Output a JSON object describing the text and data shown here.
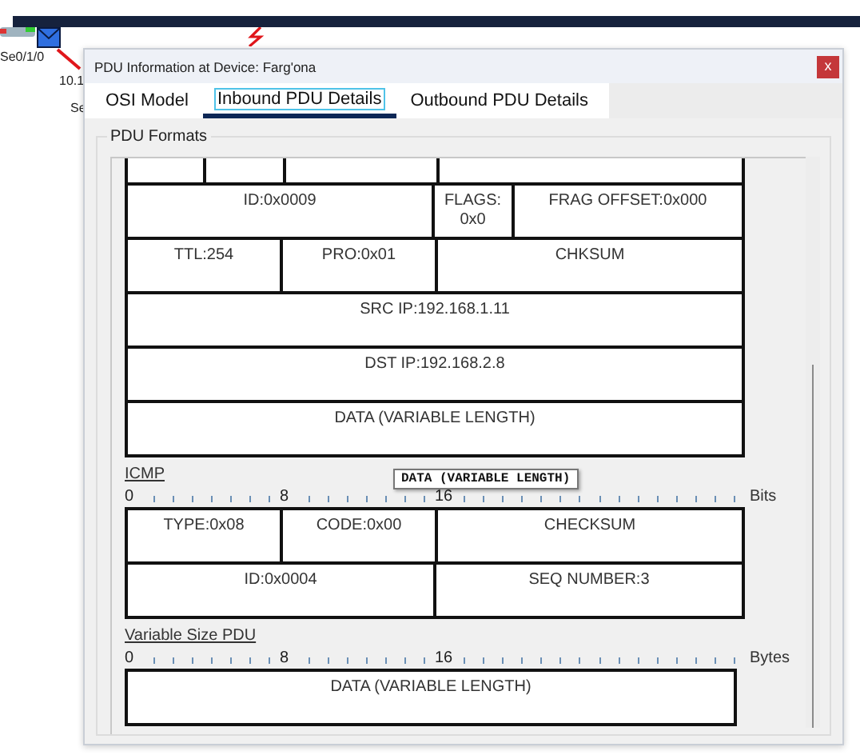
{
  "canvas": {
    "labels": [
      "Se0/1/0",
      "10.1",
      "Se"
    ]
  },
  "dialog": {
    "title": "PDU Information at Device: Farg'ona",
    "close": "x",
    "tabs": [
      {
        "label": "OSI Model",
        "selected": false
      },
      {
        "label": "Inbound PDU Details",
        "selected": true
      },
      {
        "label": "Outbound PDU Details",
        "selected": false
      }
    ],
    "group_title": "PDU Formats",
    "sections": [
      {
        "kind": "ip",
        "cut_row": true,
        "rows": [
          {
            "fields": [
              "ID:0x0009",
              "FLAGS: 0x0",
              "FRAG OFFSET:0x000"
            ]
          },
          {
            "fields": [
              "TTL:254",
              "PRO:0x01",
              "CHKSUM"
            ]
          },
          {
            "fields": [
              "SRC IP:192.168.1.11"
            ]
          },
          {
            "fields": [
              "DST IP:192.168.2.8"
            ]
          },
          {
            "fields": [
              "DATA (VARIABLE LENGTH)"
            ]
          }
        ]
      },
      {
        "kind": "icmp",
        "title": "ICMP",
        "ruler": {
          "marks": [
            "0",
            "8",
            "16"
          ],
          "unit": "Bits"
        },
        "rows": [
          {
            "fields": [
              "TYPE:0x08",
              "CODE:0x00",
              "CHECKSUM"
            ]
          },
          {
            "fields": [
              "ID:0x0004",
              "SEQ NUMBER:3"
            ]
          }
        ]
      },
      {
        "kind": "variable",
        "title": "Variable Size PDU",
        "ruler": {
          "marks": [
            "0",
            "8",
            "16"
          ],
          "unit": "Bytes"
        },
        "rows": [
          {
            "fields": [
              "DATA (VARIABLE LENGTH)"
            ]
          }
        ]
      }
    ],
    "tooltip": "DATA (VARIABLE LENGTH)"
  }
}
